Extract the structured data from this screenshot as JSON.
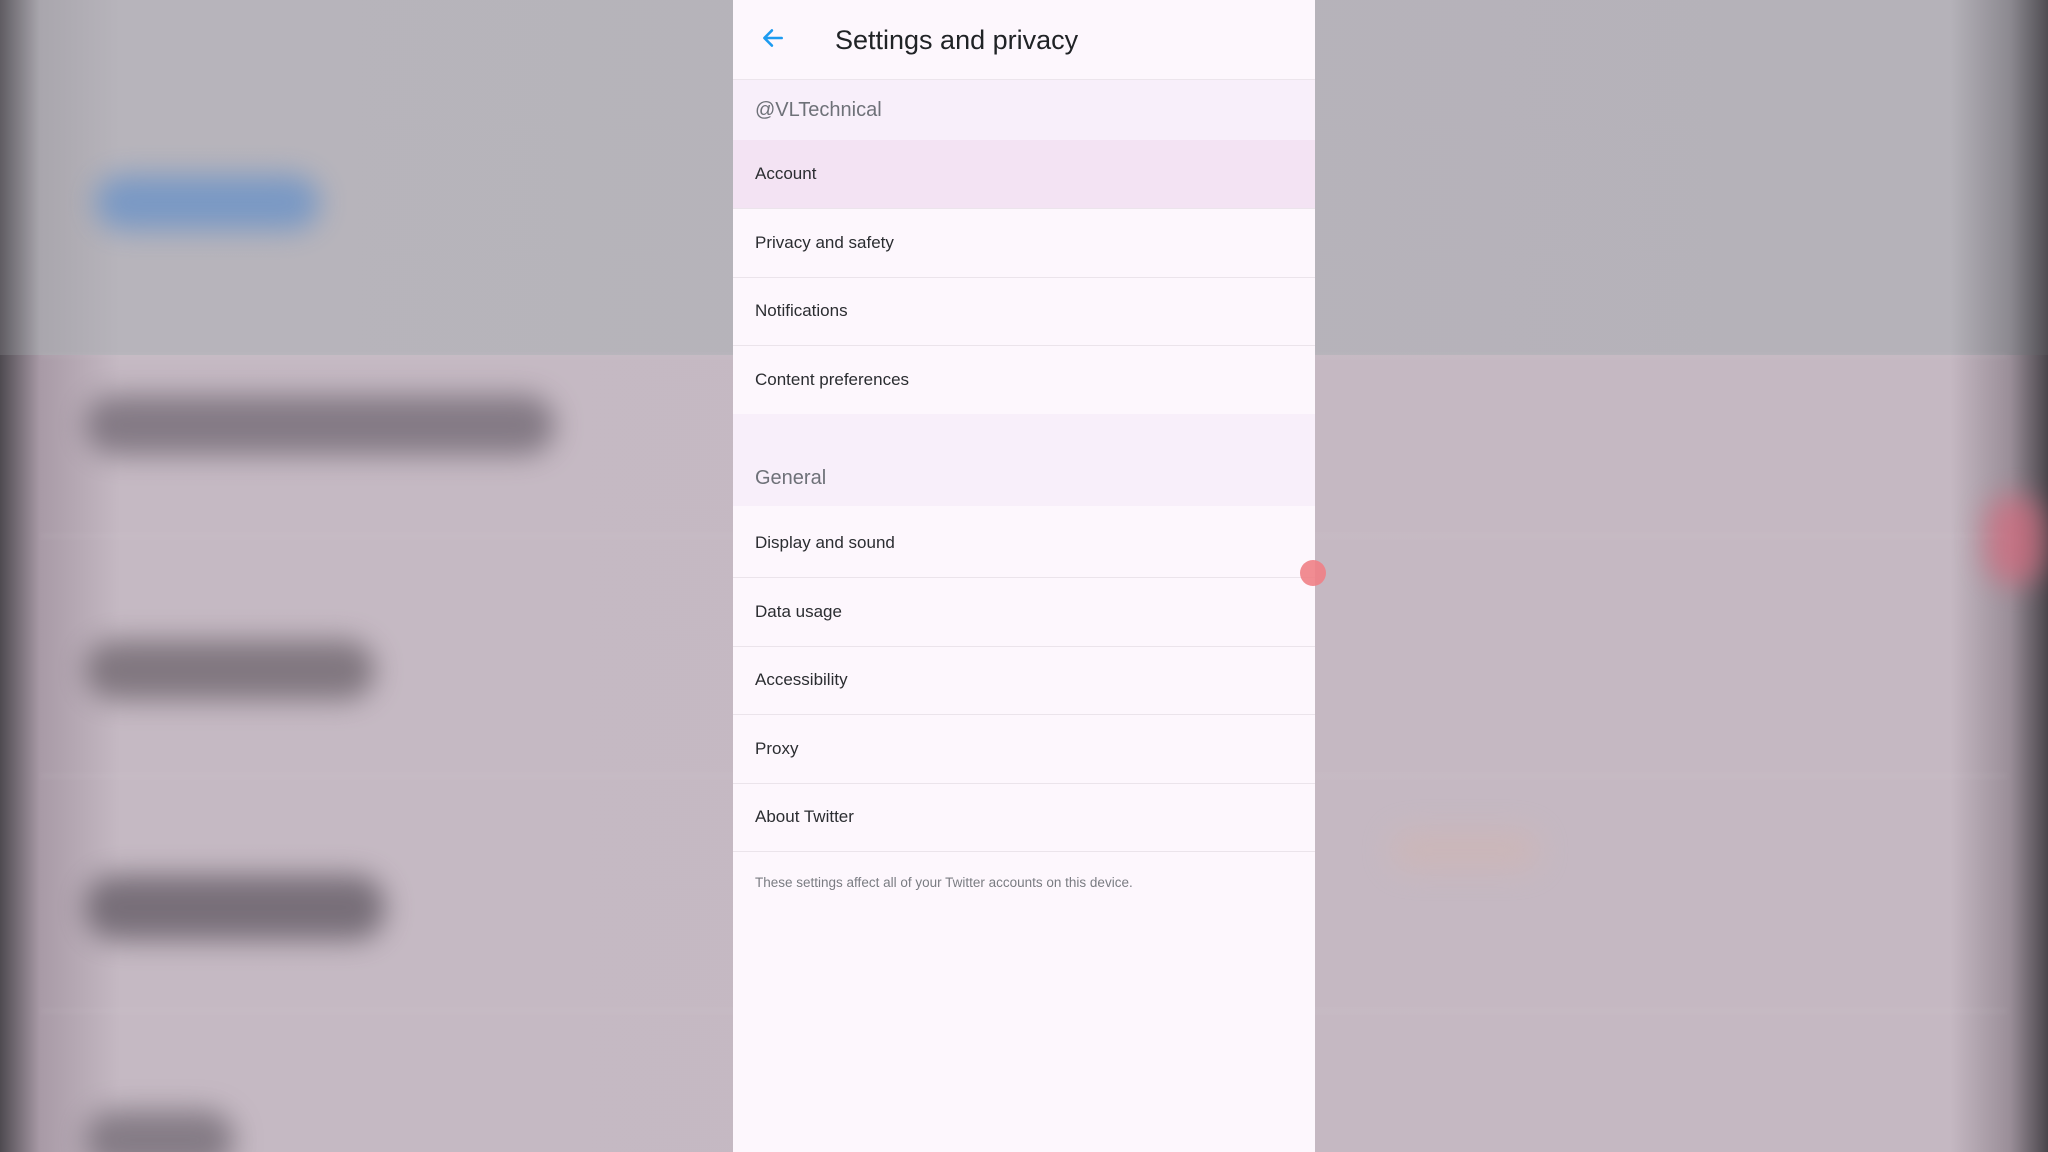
{
  "header": {
    "title": "Settings and privacy",
    "back_icon": "arrow-left-icon",
    "accent_color": "#1d9bf0"
  },
  "account_section": {
    "handle": "@VLTechnical",
    "items": [
      {
        "label": "Account",
        "selected": true
      },
      {
        "label": "Privacy and safety",
        "selected": false
      },
      {
        "label": "Notifications",
        "selected": false
      },
      {
        "label": "Content preferences",
        "selected": false
      }
    ]
  },
  "general_section": {
    "title": "General",
    "items": [
      {
        "label": "Display and sound"
      },
      {
        "label": "Data usage"
      },
      {
        "label": "Accessibility"
      },
      {
        "label": "Proxy"
      },
      {
        "label": "About Twitter"
      }
    ]
  },
  "footnote": "These settings affect all of your Twitter accounts on this device."
}
